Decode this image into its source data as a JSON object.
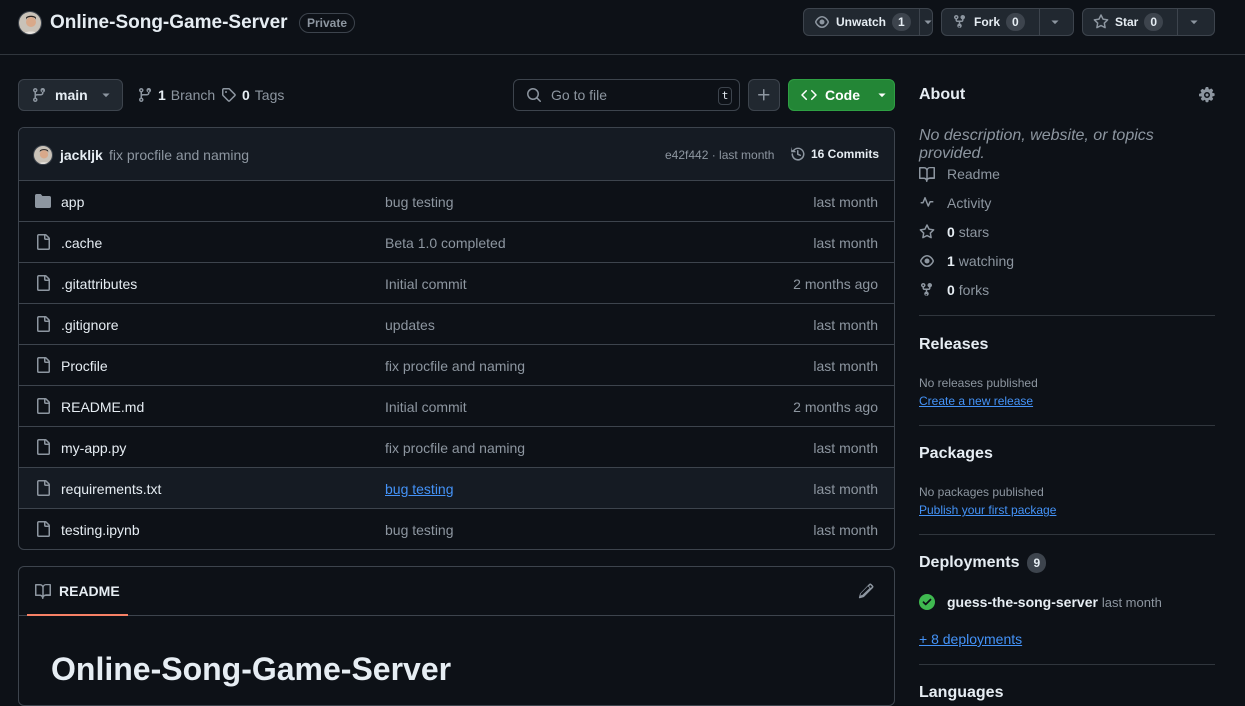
{
  "repo": {
    "name": "Online-Song-Game-Server",
    "visibility": "Private"
  },
  "actions": {
    "watch_label": "Unwatch",
    "watch_count": "1",
    "fork_label": "Fork",
    "fork_count": "0",
    "star_label": "Star",
    "star_count": "0"
  },
  "toolbar": {
    "branch": "main",
    "branches_count": "1",
    "branches_label": "Branch",
    "tags_count": "0",
    "tags_label": "Tags",
    "goto_placeholder": "Go to file",
    "goto_shortcut": "t",
    "code_label": "Code"
  },
  "latest_commit": {
    "author": "jackljk",
    "message": "fix procfile and naming",
    "sha_time": "e42f442 · last month",
    "commits_label": "16 Commits"
  },
  "files": [
    {
      "type": "folder",
      "name": "app",
      "message": "bug testing",
      "date": "last month"
    },
    {
      "type": "file",
      "name": ".cache",
      "message": "Beta 1.0 completed",
      "date": "last month"
    },
    {
      "type": "file",
      "name": ".gitattributes",
      "message": "Initial commit",
      "date": "2 months ago"
    },
    {
      "type": "file",
      "name": ".gitignore",
      "message": "updates",
      "date": "last month"
    },
    {
      "type": "file",
      "name": "Procfile",
      "message": "fix procfile and naming",
      "date": "last month"
    },
    {
      "type": "file",
      "name": "README.md",
      "message": "Initial commit",
      "date": "2 months ago"
    },
    {
      "type": "file",
      "name": "my-app.py",
      "message": "fix procfile and naming",
      "date": "last month"
    },
    {
      "type": "file",
      "name": "requirements.txt",
      "message": "bug testing",
      "date": "last month"
    },
    {
      "type": "file",
      "name": "testing.ipynb",
      "message": "bug testing",
      "date": "last month"
    }
  ],
  "readme": {
    "tab_label": "README",
    "heading": "Online-Song-Game-Server"
  },
  "about": {
    "title": "About",
    "description": "No description, website, or topics provided.",
    "items": [
      {
        "icon": "book-icon",
        "count": "",
        "label": "Readme"
      },
      {
        "icon": "pulse-icon",
        "count": "",
        "label": "Activity"
      },
      {
        "icon": "star-icon",
        "count": "0",
        "label": "stars"
      },
      {
        "icon": "eye-icon",
        "count": "1",
        "label": "watching"
      },
      {
        "icon": "fork-icon",
        "count": "0",
        "label": "forks"
      }
    ]
  },
  "releases": {
    "title": "Releases",
    "note": "No releases published",
    "link": "Create a new release"
  },
  "packages": {
    "title": "Packages",
    "note": "No packages published",
    "link": "Publish your first package"
  },
  "deployments": {
    "title": "Deployments",
    "count": "9",
    "item_name": "guess-the-song-server",
    "item_time": "last month",
    "more": "+ 8 deployments"
  },
  "languages": {
    "title": "Languages"
  },
  "colors": {
    "bg": "#0d1117",
    "border": "#3d444d",
    "accent_green": "#238636",
    "link_blue": "#4493f8",
    "success": "#3fb950",
    "tab_underline": "#f78166"
  }
}
